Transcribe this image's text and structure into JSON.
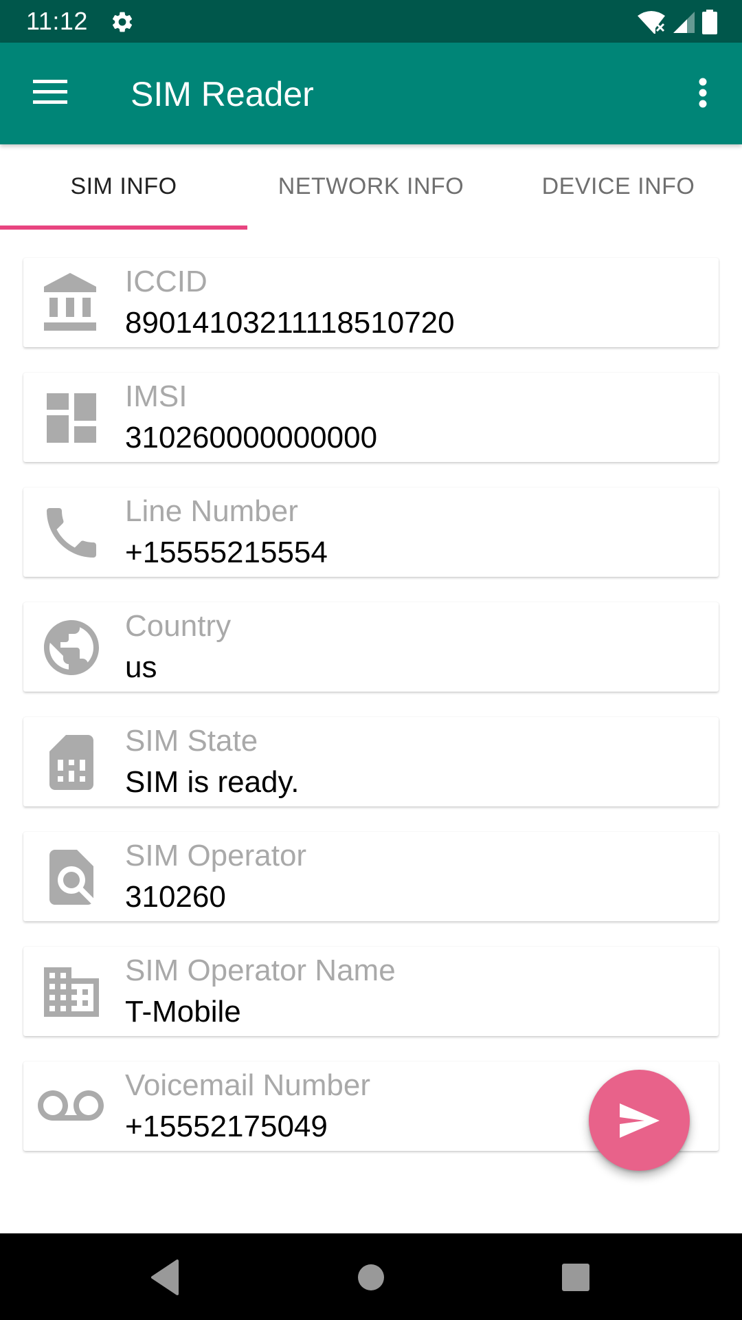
{
  "status_bar": {
    "time": "11:12",
    "icons": [
      "settings-gear-icon",
      "wifi-off-icon",
      "cell-signal-icon",
      "battery-icon"
    ]
  },
  "app_bar": {
    "title": "SIM Reader",
    "menu_icon": "hamburger-menu-icon",
    "overflow_icon": "more-vert-icon"
  },
  "tabs": [
    {
      "label": "SIM INFO",
      "active": true
    },
    {
      "label": "NETWORK INFO",
      "active": false
    },
    {
      "label": "DEVICE INFO",
      "active": false
    }
  ],
  "cards": [
    {
      "icon": "bank-icon",
      "label": "ICCID",
      "value": "89014103211118510720"
    },
    {
      "icon": "dashboard-icon",
      "label": "IMSI",
      "value": "310260000000000"
    },
    {
      "icon": "phone-icon",
      "label": "Line Number",
      "value": "+15555215554"
    },
    {
      "icon": "globe-icon",
      "label": "Country",
      "value": "us"
    },
    {
      "icon": "sim-card-icon",
      "label": "SIM State",
      "value": "SIM is ready."
    },
    {
      "icon": "find-in-page-icon",
      "label": "SIM Operator",
      "value": "310260"
    },
    {
      "icon": "business-icon",
      "label": "SIM Operator Name",
      "value": "T-Mobile"
    },
    {
      "icon": "voicemail-icon",
      "label": "Voicemail Number",
      "value": "+15552175049"
    }
  ],
  "fab": {
    "icon": "send-icon"
  },
  "nav_bar": {
    "buttons": [
      "back",
      "home",
      "recents"
    ]
  },
  "colors": {
    "status_bar": "#00574B",
    "primary": "#008577",
    "accent": "#E84480",
    "fab": "#E8628A",
    "label_gray": "#A9A9A9",
    "icon_gray": "#ABABAB"
  }
}
